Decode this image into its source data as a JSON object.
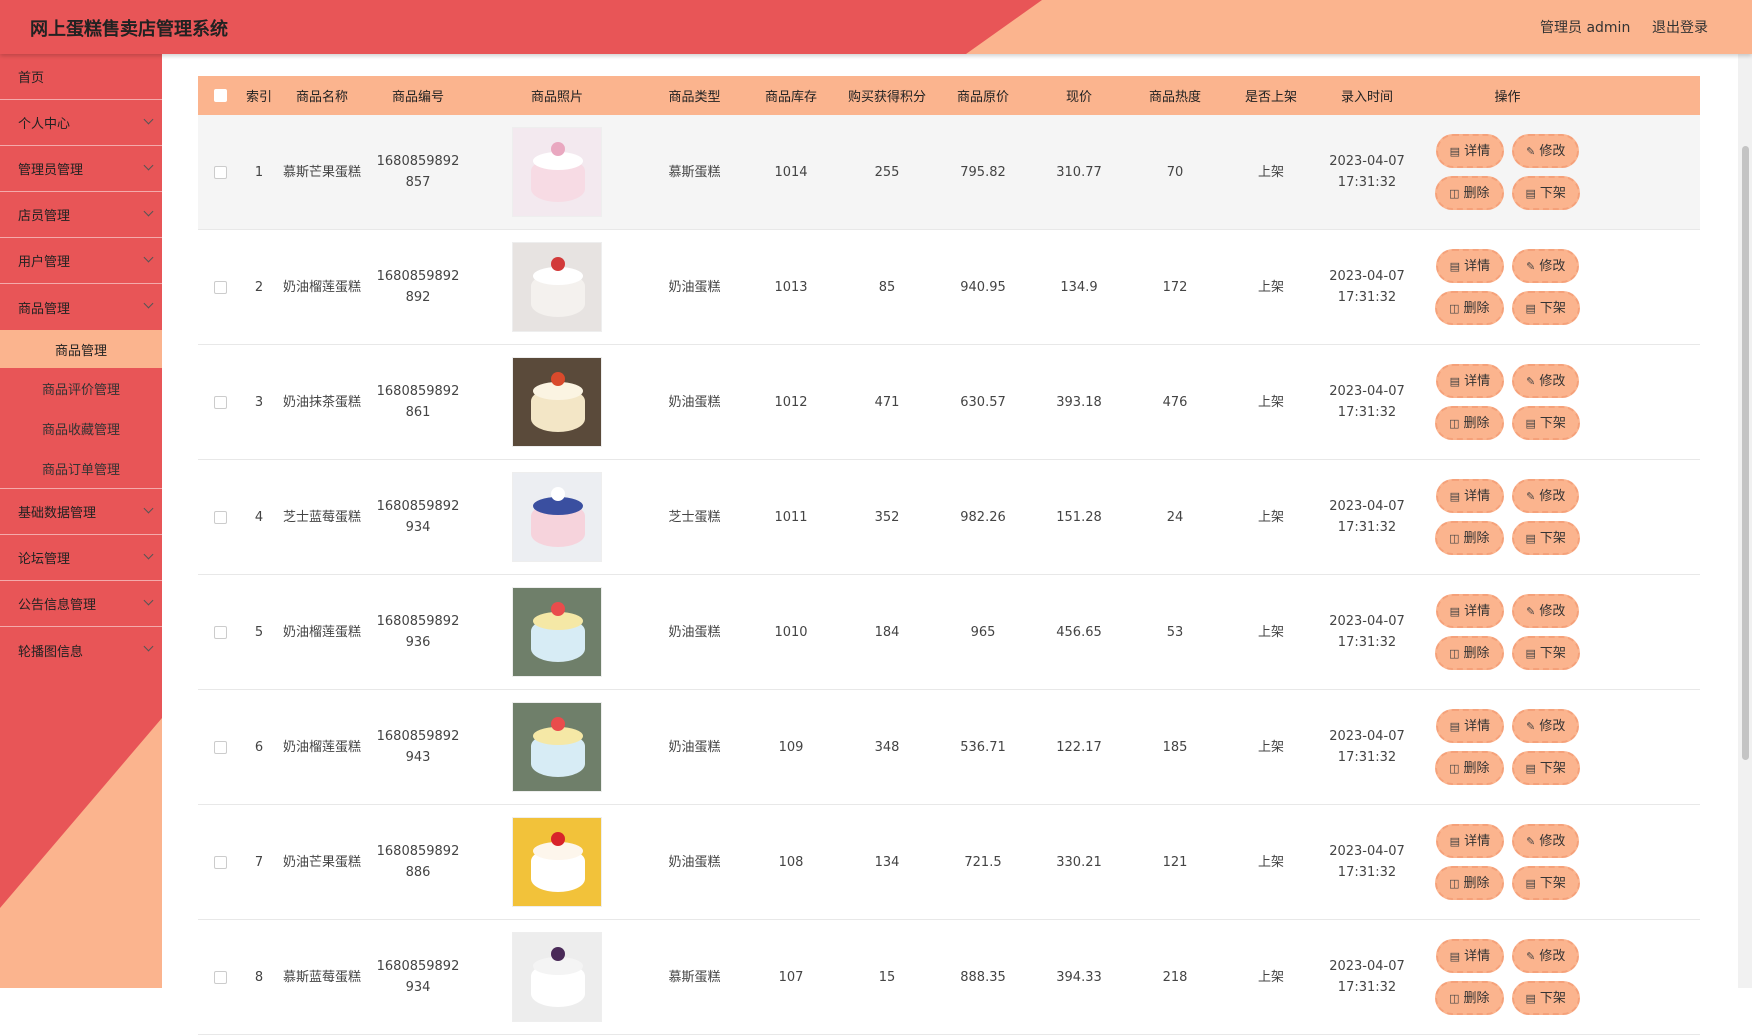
{
  "header": {
    "title": "网上蛋糕售卖店管理系统",
    "admin_label": "管理员 admin",
    "logout_label": "退出登录"
  },
  "sidebar": {
    "items": [
      {
        "label": "首页"
      },
      {
        "label": "个人中心"
      },
      {
        "label": "管理员管理"
      },
      {
        "label": "店员管理"
      },
      {
        "label": "用户管理"
      },
      {
        "label": "商品管理"
      }
    ],
    "sub_items": [
      {
        "label": "商品管理"
      },
      {
        "label": "商品评价管理"
      },
      {
        "label": "商品收藏管理"
      },
      {
        "label": "商品订单管理"
      }
    ],
    "items_after": [
      {
        "label": "基础数据管理"
      },
      {
        "label": "论坛管理"
      },
      {
        "label": "公告信息管理"
      },
      {
        "label": "轮播图信息"
      }
    ]
  },
  "table": {
    "columns": [
      "索引",
      "商品名称",
      "商品编号",
      "商品照片",
      "商品类型",
      "商品库存",
      "购买获得积分",
      "商品原价",
      "现价",
      "商品热度",
      "是否上架",
      "录入时间",
      "操作"
    ],
    "buttons": {
      "detail": "详情",
      "edit": "修改",
      "delete": "删除",
      "offshelf": "下架"
    },
    "rows": [
      {
        "index": "1",
        "name": "慕斯芒果蛋糕",
        "code1": "1680859892",
        "code2": "857",
        "type": "慕斯蛋糕",
        "stock": "1014",
        "points": "255",
        "orig": "795.82",
        "price": "310.77",
        "heat": "70",
        "shelf": "上架",
        "date": "2023-04-07",
        "time": "17:31:32"
      },
      {
        "index": "2",
        "name": "奶油榴莲蛋糕",
        "code1": "1680859892",
        "code2": "892",
        "type": "奶油蛋糕",
        "stock": "1013",
        "points": "85",
        "orig": "940.95",
        "price": "134.9",
        "heat": "172",
        "shelf": "上架",
        "date": "2023-04-07",
        "time": "17:31:32"
      },
      {
        "index": "3",
        "name": "奶油抹茶蛋糕",
        "code1": "1680859892",
        "code2": "861",
        "type": "奶油蛋糕",
        "stock": "1012",
        "points": "471",
        "orig": "630.57",
        "price": "393.18",
        "heat": "476",
        "shelf": "上架",
        "date": "2023-04-07",
        "time": "17:31:32"
      },
      {
        "index": "4",
        "name": "芝士蓝莓蛋糕",
        "code1": "1680859892",
        "code2": "934",
        "type": "芝士蛋糕",
        "stock": "1011",
        "points": "352",
        "orig": "982.26",
        "price": "151.28",
        "heat": "24",
        "shelf": "上架",
        "date": "2023-04-07",
        "time": "17:31:32"
      },
      {
        "index": "5",
        "name": "奶油榴莲蛋糕",
        "code1": "1680859892",
        "code2": "936",
        "type": "奶油蛋糕",
        "stock": "1010",
        "points": "184",
        "orig": "965",
        "price": "456.65",
        "heat": "53",
        "shelf": "上架",
        "date": "2023-04-07",
        "time": "17:31:32"
      },
      {
        "index": "6",
        "name": "奶油榴莲蛋糕",
        "code1": "1680859892",
        "code2": "943",
        "type": "奶油蛋糕",
        "stock": "109",
        "points": "348",
        "orig": "536.71",
        "price": "122.17",
        "heat": "185",
        "shelf": "上架",
        "date": "2023-04-07",
        "time": "17:31:32"
      },
      {
        "index": "7",
        "name": "奶油芒果蛋糕",
        "code1": "1680859892",
        "code2": "886",
        "type": "奶油蛋糕",
        "stock": "108",
        "points": "134",
        "orig": "721.5",
        "price": "330.21",
        "heat": "121",
        "shelf": "上架",
        "date": "2023-04-07",
        "time": "17:31:32"
      },
      {
        "index": "8",
        "name": "慕斯蓝莓蛋糕",
        "code1": "1680859892",
        "code2": "934",
        "type": "慕斯蛋糕",
        "stock": "107",
        "points": "15",
        "orig": "888.35",
        "price": "394.33",
        "heat": "218",
        "shelf": "上架",
        "date": "2023-04-07",
        "time": "17:31:32"
      }
    ]
  },
  "colors": {
    "accent_red": "#e85557",
    "accent_peach": "#fbb48e"
  }
}
